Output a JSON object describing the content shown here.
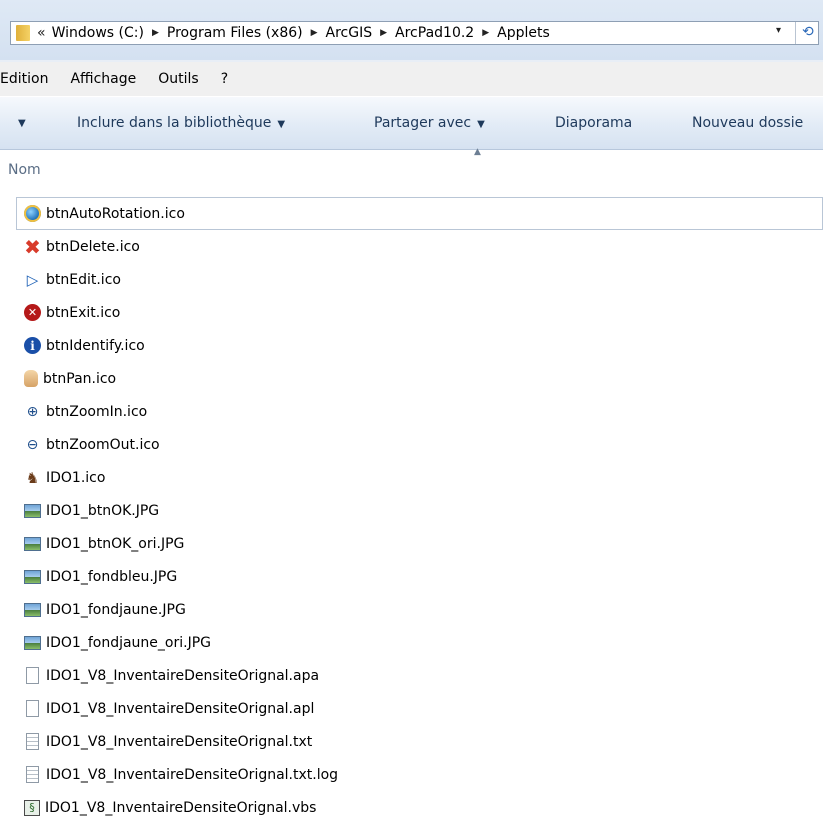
{
  "address": {
    "overflow_glyph": "«",
    "crumbs": [
      "Windows (C:)",
      "Program Files (x86)",
      "ArcGIS",
      "ArcPad10.2",
      "Applets"
    ],
    "separator_glyph": "▶",
    "dropdown_glyph": "▾",
    "refresh_glyph": "⟲"
  },
  "menu": {
    "items": [
      "Edition",
      "Affichage",
      "Outils",
      "?"
    ]
  },
  "toolbar": {
    "organize_arrow": "▼",
    "include_label": "Inclure dans la bibliothèque",
    "share_label": "Partager avec",
    "slideshow_label": "Diaporama",
    "new_folder_label": "Nouveau dossie",
    "dropdown_glyph": "▼"
  },
  "columns": {
    "name_header": "Nom",
    "sort_glyph": "▲"
  },
  "files": [
    {
      "name": "btnAutoRotation.ico",
      "icon": "globe-icon"
    },
    {
      "name": "btnDelete.ico",
      "icon": "delete-x-icon"
    },
    {
      "name": "btnEdit.ico",
      "icon": "arrow-pointer-icon"
    },
    {
      "name": "btnExit.ico",
      "icon": "exit-circle-icon"
    },
    {
      "name": "btnIdentify.ico",
      "icon": "info-icon"
    },
    {
      "name": "btnPan.ico",
      "icon": "hand-icon"
    },
    {
      "name": "btnZoomIn.ico",
      "icon": "zoom-in-icon"
    },
    {
      "name": "btnZoomOut.ico",
      "icon": "zoom-out-icon"
    },
    {
      "name": "IDO1.ico",
      "icon": "moose-icon"
    },
    {
      "name": "IDO1_btnOK.JPG",
      "icon": "image-file-icon"
    },
    {
      "name": "IDO1_btnOK_ori.JPG",
      "icon": "image-file-icon"
    },
    {
      "name": "IDO1_fondbleu.JPG",
      "icon": "image-file-icon"
    },
    {
      "name": "IDO1_fondjaune.JPG",
      "icon": "image-file-icon"
    },
    {
      "name": "IDO1_fondjaune_ori.JPG",
      "icon": "image-file-icon"
    },
    {
      "name": "IDO1_V8_InventaireDensiteOrignal.apa",
      "icon": "blank-file-icon"
    },
    {
      "name": "IDO1_V8_InventaireDensiteOrignal.apl",
      "icon": "blank-file-icon"
    },
    {
      "name": "IDO1_V8_InventaireDensiteOrignal.txt",
      "icon": "text-file-icon"
    },
    {
      "name": "IDO1_V8_InventaireDensiteOrignal.txt.log",
      "icon": "text-file-icon"
    },
    {
      "name": "IDO1_V8_InventaireDensiteOrignal.vbs",
      "icon": "script-file-icon"
    }
  ]
}
